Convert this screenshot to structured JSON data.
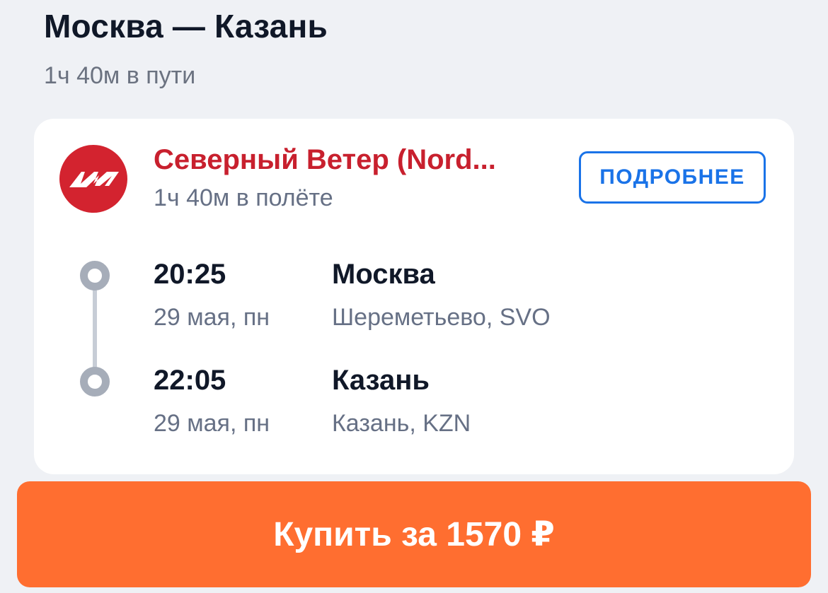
{
  "route": {
    "title": "Москва — Казань",
    "total_duration": "1ч 40м в пути"
  },
  "flight_card": {
    "airline": {
      "name": "Северный Ветер (Nord...",
      "logo_color": "#d3232f",
      "flight_duration": "1ч 40м в полёте"
    },
    "details_button_label": "ПОДРОБНЕЕ",
    "departure": {
      "time": "20:25",
      "date": "29 мая, пн",
      "city": "Москва",
      "airport": "Шереметьево, SVO"
    },
    "arrival": {
      "time": "22:05",
      "date": "29 мая, пн",
      "city": "Казань",
      "airport": "Казань, KZN"
    }
  },
  "buy_button": {
    "label": "Купить за 1570 ₽",
    "color": "#ff6e30"
  },
  "colors": {
    "accent_blue": "#1a73e8",
    "airline_red": "#c8202e",
    "background": "#eff1f5"
  },
  "icons": {
    "airline_logo": "nordwind-logo-icon",
    "timeline_dot": "timeline-dot-icon"
  }
}
